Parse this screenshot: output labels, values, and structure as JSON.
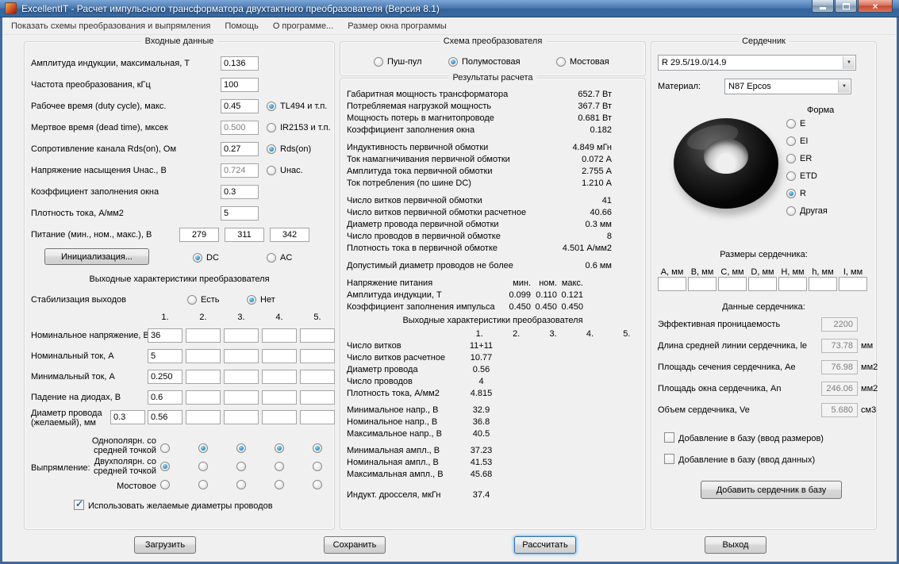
{
  "colors": {
    "titlebar_top": "#7da7d9",
    "titlebar_bottom": "#35639d",
    "radio_selected": "#1f86c0",
    "focus_ring": "#7ab8e8"
  },
  "window": {
    "title": "ExcellentIT - Расчет импульсного трансформатора двухтактного преобразователя (Версия 8.1)"
  },
  "menu": {
    "items": [
      "Показать схемы преобразования и выпрямления",
      "Помощь",
      "О программе...",
      "Размер окна программы"
    ]
  },
  "inputs": {
    "title": "Входные данные",
    "rows": [
      {
        "label": "Амплитуда индукции, максимальная, Т",
        "value": "0.136"
      },
      {
        "label": "Частота преобразования, кГц",
        "value": "100"
      },
      {
        "label": "Рабочее время (duty cycle), макс.",
        "value": "0.45",
        "radio": "TL494 и т.п.",
        "checked": true
      },
      {
        "label": "Мертвое время (dead time), мксек",
        "value": "0.500",
        "radio": "IR2153 и т.п.",
        "checked": false
      },
      {
        "label": "Сопротивление канала Rds(on), Ом",
        "value": "0.27",
        "radio": "Rds(on)",
        "checked": true
      },
      {
        "label": "Напряжение насыщения Uнас., В",
        "value": "0.724",
        "radio": "Uнас.",
        "checked": false
      },
      {
        "label": "Коэффициент заполнения окна",
        "value": "0.3"
      },
      {
        "label": "Плотность тока, А/мм2",
        "value": "5"
      }
    ],
    "supply": {
      "label": "Питание (мин., ном., макс.), В",
      "values": [
        "279",
        "311",
        "342"
      ]
    },
    "init_button": "Инициализация...",
    "dc": {
      "label": "DC",
      "checked": true
    },
    "ac": {
      "label": "AC",
      "checked": false
    },
    "out_title": "Выходные характеристики преобразователя",
    "stab": {
      "label": "Стабилизация выходов",
      "yes": "Есть",
      "no": "Нет",
      "yes_checked": false,
      "no_checked": true
    },
    "col_headers": [
      "1.",
      "2.",
      "3.",
      "4.",
      "5."
    ],
    "out_rows": [
      {
        "label": "Номинальное напряжение, В",
        "values": [
          "36",
          "",
          "",
          "",
          ""
        ]
      },
      {
        "label": "Номинальный ток, А",
        "values": [
          "5",
          "",
          "",
          "",
          ""
        ]
      },
      {
        "label": "Минимальный ток, А",
        "values": [
          "0.250",
          "",
          "",
          "",
          ""
        ]
      },
      {
        "label": "Падение на диодах, В",
        "values": [
          "0.6",
          "",
          "",
          "",
          ""
        ]
      }
    ],
    "diameter": {
      "label": "Диаметр провода (желаемый), мм",
      "extra": "0.3",
      "values": [
        "0.56",
        "",
        "",
        "",
        ""
      ]
    },
    "rect": {
      "label": "Выпрямление:",
      "rows": [
        {
          "label": "Однополярн. со средней точкой",
          "checked": [
            false,
            true,
            true,
            true,
            true
          ]
        },
        {
          "label": "Двухполярн. со средней точкой",
          "checked": [
            true,
            false,
            false,
            false,
            false
          ]
        },
        {
          "label": "Мостовое",
          "checked": [
            false,
            false,
            false,
            false,
            false
          ]
        }
      ]
    },
    "use_diam": {
      "label": "Использовать желаемые диаметры проводов",
      "checked": true
    }
  },
  "scheme": {
    "title": "Схема преобразователя",
    "options": [
      {
        "label": "Пуш-пул",
        "checked": false
      },
      {
        "label": "Полумостовая",
        "checked": true
      },
      {
        "label": "Мостовая",
        "checked": false
      }
    ]
  },
  "results": {
    "title": "Результаты расчета",
    "rows": [
      {
        "label": "Габаритная мощность трансформатора",
        "value": "652.7 Вт"
      },
      {
        "label": "Потребляемая нагрузкой мощность",
        "value": "367.7 Вт"
      },
      {
        "label": "Мощность потерь в магнитопроводе",
        "value": "0.681 Вт"
      },
      {
        "label": "Коэффициент заполнения окна",
        "value": "0.182"
      },
      {
        "label": "Индуктивность первичной обмотки",
        "value": "4.849 мГн"
      },
      {
        "label": "Ток намагничивания первичной обмотки",
        "value": "0.072 А"
      },
      {
        "label": "Амплитуда тока первичной обмотки",
        "value": "2.755 А"
      },
      {
        "label": "Ток потребления (по шине DC)",
        "value": "1.210 А"
      },
      {
        "label": "Число витков первичной обмотки",
        "value": "41"
      },
      {
        "label": "Число витков первичной обмотки расчетное",
        "value": "40.66"
      },
      {
        "label": "Диаметр провода первичной обмотки",
        "value": "0.3 мм"
      },
      {
        "label": "Число проводов в первичной обмотке",
        "value": "8"
      },
      {
        "label": "Плотность тока в первичной обмотке",
        "value": "4.501 А/мм2"
      },
      {
        "label": "Допустимый диаметр проводов не более",
        "value": "0.6 мм"
      }
    ],
    "supply_header": {
      "label": "Напряжение питания",
      "cols": [
        "мин.",
        "ном.",
        "макс."
      ]
    },
    "supply_rows": [
      {
        "label": "Амплитуда индукции, Т",
        "values": [
          "0.099",
          "0.110",
          "0.121"
        ]
      },
      {
        "label": "Коэффициент заполнения импульса",
        "values": [
          "0.450",
          "0.450",
          "0.450"
        ]
      }
    ],
    "out_title": "Выходные характеристики преобразователя",
    "col_headers": [
      "1.",
      "2.",
      "3.",
      "4.",
      "5."
    ],
    "out_rows": [
      {
        "label": "Число витков",
        "value": "11+11"
      },
      {
        "label": "Число витков расчетное",
        "value": "10.77"
      },
      {
        "label": "Диаметр провода",
        "value": "0.56"
      },
      {
        "label": "Число проводов",
        "value": "4"
      },
      {
        "label": "Плотность тока, А/мм2",
        "value": "4.815"
      },
      {
        "label": "Минимальное напр., В",
        "value": "32.9"
      },
      {
        "label": "Номинальное напр., В",
        "value": "36.8"
      },
      {
        "label": "Максимальное напр., В",
        "value": "40.5"
      },
      {
        "label": "Минимальная ампл., В",
        "value": "37.23"
      },
      {
        "label": "Номинальная ампл., В",
        "value": "41.53"
      },
      {
        "label": "Максимальная ампл., В",
        "value": "45.68"
      },
      {
        "label": "Индукт. дросселя, мкГн",
        "value": "37.4"
      }
    ]
  },
  "core": {
    "title": "Сердечник",
    "core_select": "R 29.5/19.0/14.9",
    "material_label": "Материал:",
    "material_select": "N87 Epcos",
    "shape_title": "Форма",
    "shapes": [
      {
        "label": "E",
        "checked": false
      },
      {
        "label": "EI",
        "checked": false
      },
      {
        "label": "ER",
        "checked": false
      },
      {
        "label": "ETD",
        "checked": false
      },
      {
        "label": "R",
        "checked": true
      },
      {
        "label": "Другая",
        "checked": false
      }
    ],
    "dims_title": "Размеры сердечника:",
    "dim_labels": [
      "A, мм",
      "B, мм",
      "C, мм",
      "D, мм",
      "H, мм",
      "h, мм",
      "I, мм"
    ],
    "data_title": "Данные сердечника:",
    "data_rows": [
      {
        "label": "Эффективная проницаемость",
        "value": "2200",
        "unit": ""
      },
      {
        "label": "Длина средней линии сердечника, le",
        "value": "73.78",
        "unit": "мм"
      },
      {
        "label": "Площадь сечения сердечника, Ae",
        "value": "76.98",
        "unit": "мм2"
      },
      {
        "label": "Площадь окна сердечника, An",
        "value": "246.06",
        "unit": "мм2"
      },
      {
        "label": "Объем сердечника, Ve",
        "value": "5.680",
        "unit": "см3"
      }
    ],
    "add_size_label": "Добавление в базу (ввод размеров)",
    "add_data_label": "Добавление в базу (ввод данных)",
    "add_size_checked": false,
    "add_data_checked": false,
    "add_button": "Добавить сердечник в базу"
  },
  "footer": {
    "load": "Загрузить",
    "save": "Сохранить",
    "calc": "Рассчитать",
    "exit": "Выход"
  }
}
